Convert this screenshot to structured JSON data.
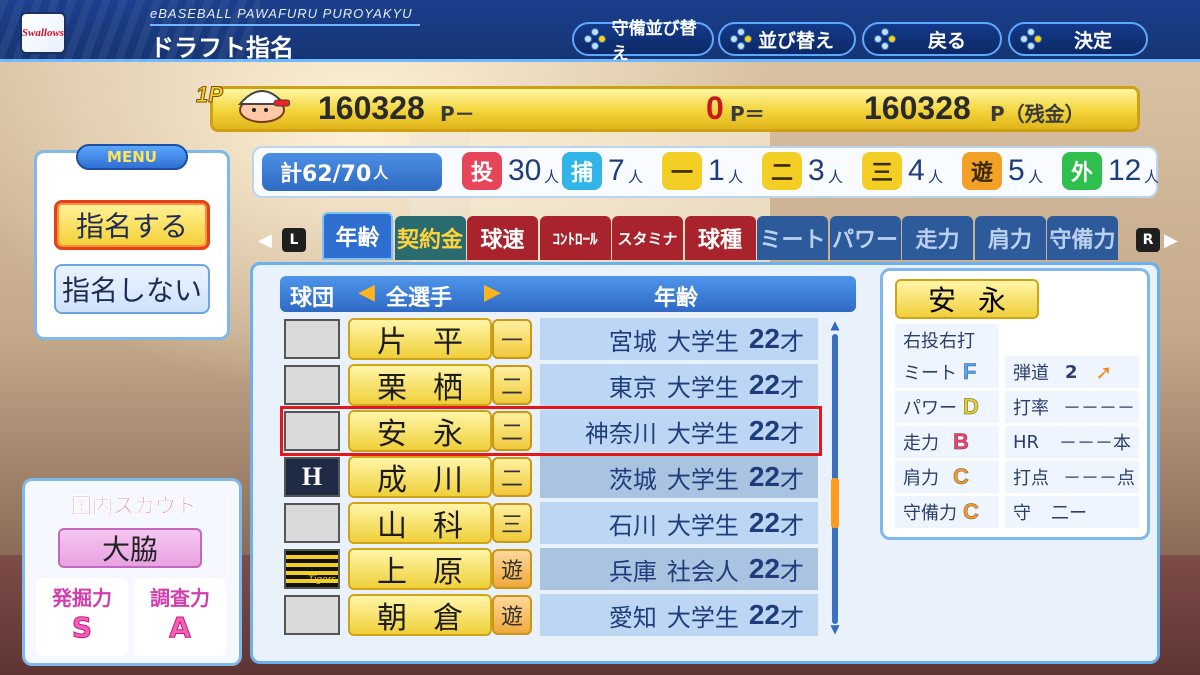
{
  "header": {
    "team_logo_text": "Swallows",
    "game_name": "eBASEBALL PAWAFURU PUROYAKYU",
    "title": "ドラフト指名",
    "buttons": [
      {
        "label": "守備並び替え"
      },
      {
        "label": "並び替え"
      },
      {
        "label": "戻る"
      },
      {
        "label": "決定"
      }
    ]
  },
  "money": {
    "player_tag": "1P",
    "points_left": "160328",
    "points_left_unit": "P－",
    "points_used": "0",
    "points_used_unit": "P＝",
    "points_remaining": "160328",
    "points_remaining_unit": "P（残金）"
  },
  "counts": {
    "total_label": "計62/70",
    "total_unit": "人",
    "positions": [
      {
        "badge": "投",
        "num": "30",
        "unit": "人",
        "color": "#e7465a"
      },
      {
        "badge": "捕",
        "num": "7",
        "unit": "人",
        "color": "#31b5e8"
      },
      {
        "badge": "一",
        "num": "1",
        "unit": "人",
        "color": "#f3cf26"
      },
      {
        "badge": "二",
        "num": "3",
        "unit": "人",
        "color": "#f3cf26"
      },
      {
        "badge": "三",
        "num": "4",
        "unit": "人",
        "color": "#f3cf26"
      },
      {
        "badge": "遊",
        "num": "5",
        "unit": "人",
        "color": "#f3a126"
      },
      {
        "badge": "外",
        "num": "12",
        "unit": "人",
        "color": "#2fbf4d"
      }
    ]
  },
  "menu": {
    "title": "MENU",
    "items": [
      {
        "label": "指名する"
      },
      {
        "label": "指名しない"
      }
    ]
  },
  "scout": {
    "title": "国内スカウト",
    "name": "大脇",
    "stats": [
      {
        "label": "発掘力",
        "value": "S"
      },
      {
        "label": "調査力",
        "value": "A"
      }
    ]
  },
  "tabs": {
    "left_key": "L",
    "right_key": "R",
    "items": [
      "年齢",
      "契約金",
      "球速",
      "ｺﾝﾄﾛｰﾙ",
      "スタミナ",
      "球種",
      "ミート",
      "パワー",
      "走力",
      "肩力",
      "守備力"
    ]
  },
  "list": {
    "col_team": "球団",
    "filter": "全選手",
    "col_sort": "年齢",
    "rows": [
      {
        "name1": "片",
        "name2": "平",
        "pos": "一",
        "pref": "宮城",
        "type": "大学生",
        "age": "22",
        "age_unit": "才",
        "team": ""
      },
      {
        "name1": "栗",
        "name2": "栖",
        "pos": "二",
        "pref": "東京",
        "type": "大学生",
        "age": "22",
        "age_unit": "才",
        "team": ""
      },
      {
        "name1": "安",
        "name2": "永",
        "pos": "二",
        "pref": "神奈川",
        "type": "大学生",
        "age": "22",
        "age_unit": "才",
        "team": ""
      },
      {
        "name1": "成",
        "name2": "川",
        "pos": "二",
        "pref": "茨城",
        "type": "大学生",
        "age": "22",
        "age_unit": "才",
        "team": "H"
      },
      {
        "name1": "山",
        "name2": "科",
        "pos": "三",
        "pref": "石川",
        "type": "大学生",
        "age": "22",
        "age_unit": "才",
        "team": ""
      },
      {
        "name1": "上",
        "name2": "原",
        "pos": "遊",
        "pref": "兵庫",
        "type": "社会人",
        "age": "22",
        "age_unit": "才",
        "team": "Tigers"
      },
      {
        "name1": "朝",
        "name2": "倉",
        "pos": "遊",
        "pref": "愛知",
        "type": "大学生",
        "age": "22",
        "age_unit": "才",
        "team": ""
      }
    ]
  },
  "detail": {
    "name1": "安",
    "name2": "永",
    "throw_bat": "右投右打",
    "meet": {
      "label": "ミート",
      "grade": "F"
    },
    "trajectory": {
      "label": "弾道",
      "value": "2"
    },
    "power": {
      "label": "パワー",
      "grade": "D"
    },
    "avg": {
      "label": "打率",
      "value": "－－－－"
    },
    "speed": {
      "label": "走力",
      "grade": "B"
    },
    "hr": {
      "label": "HR",
      "value": "－－－",
      "unit": "本"
    },
    "arm": {
      "label": "肩力",
      "grade": "C"
    },
    "rbi": {
      "label": "打点",
      "value": "－－－",
      "unit": "点"
    },
    "fielding": {
      "label": "守備力",
      "grade": "C"
    },
    "defense": {
      "label": "守",
      "value": "二ー"
    }
  }
}
